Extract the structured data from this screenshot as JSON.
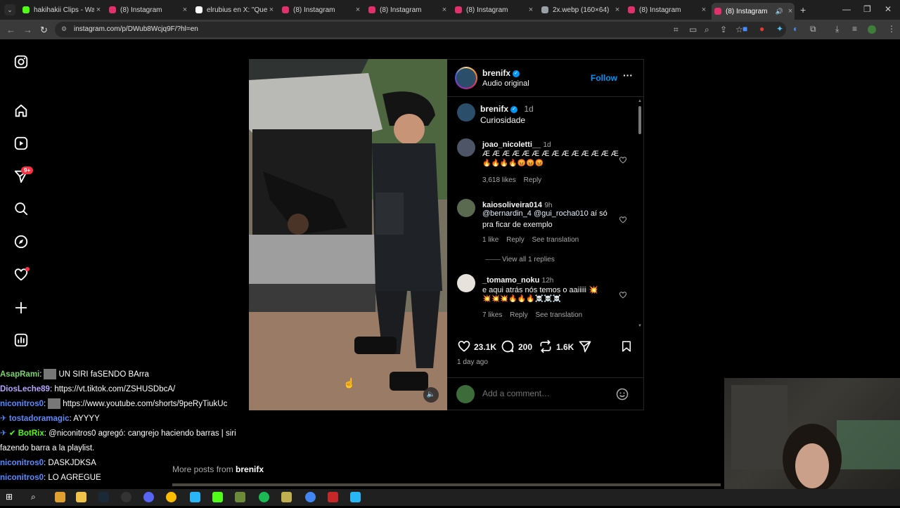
{
  "browser": {
    "tabs": [
      {
        "title": "hakihakii Clips - Watc",
        "active": false,
        "color": "#53fc18"
      },
      {
        "title": "(8) Instagram",
        "active": false,
        "color": "#e1306c"
      },
      {
        "title": "elrubius en X: \"Que s",
        "active": false,
        "color": "#ffffff"
      },
      {
        "title": "(8) Instagram",
        "active": false,
        "color": "#e1306c"
      },
      {
        "title": "(8) Instagram",
        "active": false,
        "color": "#e1306c"
      },
      {
        "title": "(8) Instagram",
        "active": false,
        "color": "#e1306c"
      },
      {
        "title": "2x.webp (160×64)",
        "active": false,
        "color": "#9aa0a6"
      },
      {
        "title": "(8) Instagram",
        "active": false,
        "color": "#e1306c"
      },
      {
        "title": "(8) Instagram",
        "active": true,
        "color": "#e1306c"
      }
    ],
    "url": "instagram.com/p/DWub8Wcjq9F/?hl=en"
  },
  "nav": {
    "notifications_badge": "9+"
  },
  "post": {
    "author": "brenifx",
    "audio": "Audio original",
    "follow_label": "Follow",
    "caption_time": "1d",
    "caption": "Curiosidade",
    "comments": [
      {
        "user": "joao_nicoletti__",
        "time": "1d",
        "text": "Æ Æ Æ Æ Æ Æ Æ Æ Æ Æ Æ Æ Æ Æ",
        "text2": "🔥🔥🔥🔥😡😡😡",
        "likes": "3,618 likes",
        "reply": "Reply",
        "translate": ""
      },
      {
        "user": "kaiosoliveira014",
        "time": "9h",
        "mention1": "@bernardin_4",
        "mention2": "@gui_rocha010",
        "text": " aí só",
        "text2": "pra ficar de exemplo",
        "likes": "1 like",
        "reply": "Reply",
        "translate": "See translation",
        "view_replies": "View all 1 replies"
      },
      {
        "user": "_tomamo_noku",
        "time": "12h",
        "text": "e aqui atrás nós temos o aaiiiii 💥",
        "text2": "💥💥💥🔥🔥🔥☠️☠️☠️",
        "likes": "7 likes",
        "reply": "Reply",
        "translate": "See translation"
      }
    ],
    "like_count": "23.1K",
    "comment_count": "200",
    "repost_count": "1.6K",
    "date": "1 day ago",
    "add_comment_placeholder": "Add a comment…"
  },
  "chat": [
    {
      "user": "AsapRami",
      "color": "#7ad36b",
      "text": "UN SIRI faSENDO BArra"
    },
    {
      "user": "DiosLeche89",
      "color": "#b9a3ff",
      "text": "https://vt.tiktok.com/ZSHUSDbcA/"
    },
    {
      "user": "niconitros0",
      "color": "#5a8cff",
      "text": "https://www.youtube.com/shorts/9peRyTiukUc"
    },
    {
      "user": "tostadoramagic",
      "color": "#5a8cff",
      "text": "AYYYY"
    },
    {
      "user": "BotRix",
      "color": "#53fc18",
      "text": "@niconitros0 agregó: cangrejo haciendo barras | siri"
    },
    {
      "user": "",
      "color": "#ffffff",
      "text": "fazendo barra a la playlist."
    },
    {
      "user": "niconitros0",
      "color": "#5a8cff",
      "text": "DASKJDKSA"
    },
    {
      "user": "niconitros0",
      "color": "#5a8cff",
      "text": "LO AGREGUE"
    }
  ],
  "more_posts": {
    "prefix": "More posts from ",
    "user": "brenifx"
  }
}
